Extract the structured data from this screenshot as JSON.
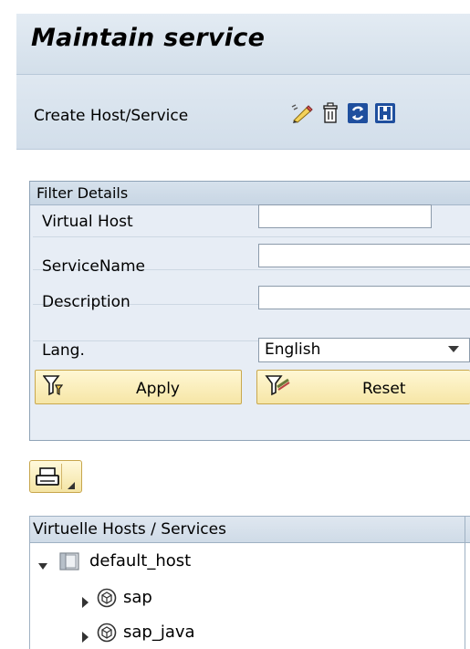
{
  "page": {
    "title": "Maintain service"
  },
  "toolbar": {
    "create_label": "Create Host/Service",
    "icons": [
      "edit-icon",
      "delete-icon",
      "refresh-icon",
      "info-icon"
    ]
  },
  "filter": {
    "header": "Filter Details",
    "fields": [
      {
        "label": "Virtual Host",
        "value": ""
      },
      {
        "label": "ServiceName",
        "value": ""
      },
      {
        "label": "Description",
        "value": ""
      }
    ],
    "lang": {
      "label": "Lang.",
      "value": "English"
    },
    "apply_label": "Apply",
    "reset_label": "Reset"
  },
  "tree": {
    "header": "Virtuelle Hosts / Services",
    "items": [
      {
        "label": "default_host",
        "expanded": true,
        "icon": "host-icon"
      },
      {
        "label": "sap",
        "expanded": false,
        "icon": "service-icon"
      },
      {
        "label": "sap_java",
        "expanded": false,
        "icon": "service-icon"
      }
    ]
  },
  "colors": {
    "accent_yellow": "#f6e6a6",
    "panel_blue": "#e7edf5",
    "header_blue": "#d3dfea"
  }
}
